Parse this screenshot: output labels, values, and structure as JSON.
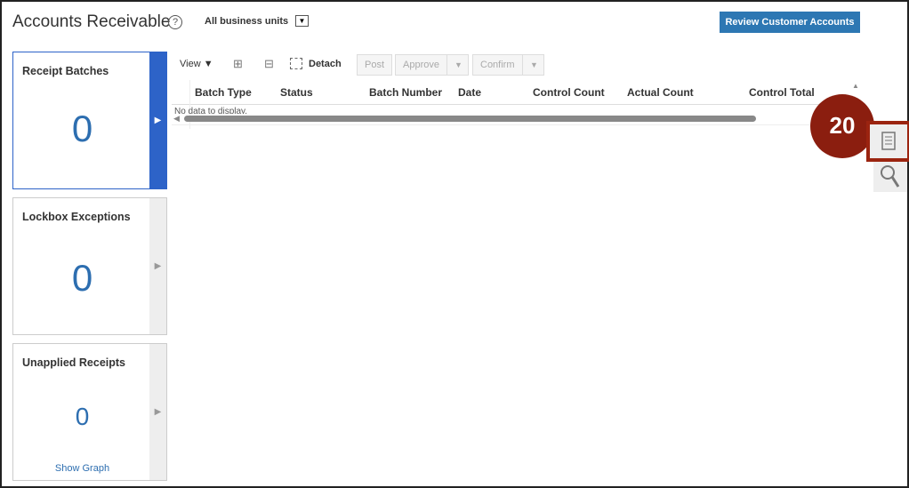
{
  "header": {
    "title": "Accounts Receivable",
    "help": "?",
    "business_unit": "All business units",
    "review_button": "Review Customer Accounts"
  },
  "cards": [
    {
      "label": "Receipt Batches",
      "count": "0"
    },
    {
      "label": "Lockbox Exceptions",
      "count": "0"
    },
    {
      "label": "Unapplied Receipts",
      "count": "0",
      "link": "Show Graph"
    }
  ],
  "toolbar": {
    "view": "View ▼",
    "detach": "Detach",
    "post": "Post",
    "approve": "Approve",
    "confirm": "Confirm"
  },
  "table": {
    "columns": [
      "Batch Type",
      "Status",
      "Batch Number",
      "Date",
      "Control Count",
      "Actual Count",
      "Control Total"
    ],
    "empty": "No data to display."
  },
  "callout": {
    "step": "20"
  }
}
